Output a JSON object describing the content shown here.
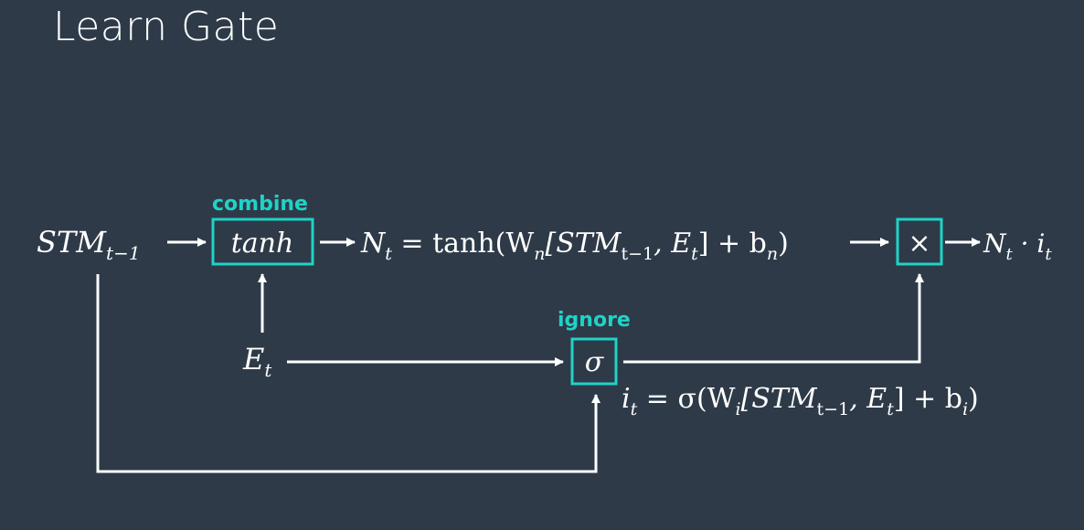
{
  "title": "Learn Gate",
  "colors": {
    "background": "#2e3a48",
    "accent": "#1fd3c6",
    "line": "#ffffff"
  },
  "labels": {
    "combine": "combine",
    "ignore": "ignore"
  },
  "boxes": {
    "tanh": "tanh",
    "sigma": "σ",
    "times": "×"
  },
  "math": {
    "stm_base": "STM",
    "stm_sub": "t−1",
    "n_base": "N",
    "n_sub": "t",
    "n_formula_rest": " = tanh(W",
    "n_formula_w_sub": "n",
    "n_formula_mid": "[STM",
    "n_formula_stm_sub": "t−1",
    "n_formula_e": ", E",
    "n_formula_e_sub": "t",
    "n_formula_end": "] + b",
    "n_formula_b_sub": "n",
    "n_formula_close": ")",
    "e_base": "E",
    "e_sub": "t",
    "i_base": "i",
    "i_sub": "t",
    "i_formula_rest": " = σ(W",
    "i_formula_w_sub": "i",
    "i_formula_mid": "[STM",
    "i_formula_stm_sub": "t−1",
    "i_formula_e": ", E",
    "i_formula_e_sub": "t",
    "i_formula_end": "] + b",
    "i_formula_b_sub": "i",
    "i_formula_close": ")",
    "out_n": "N",
    "out_n_sub": "t",
    "out_dot": " · i",
    "out_i_sub": "t"
  }
}
